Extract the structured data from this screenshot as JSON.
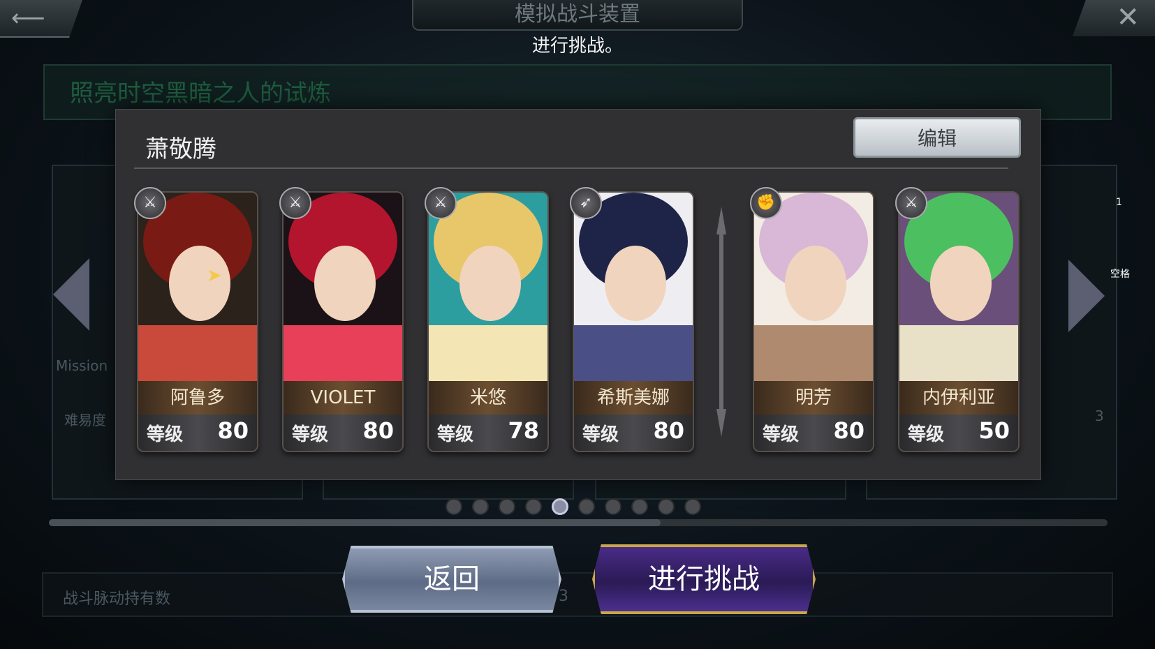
{
  "header": {
    "title": "模拟战斗装置",
    "banner": "进行挑战。"
  },
  "background": {
    "trial_title": "照亮时空黑暗之人的试炼",
    "mission_label": "Mission",
    "difficulty_label": "难易度",
    "difficulty_value": "3",
    "pulse_label": "战斗脉动持有数",
    "pulse_value": "3"
  },
  "hints": {
    "one": "1",
    "space": "空格"
  },
  "dialog": {
    "team_name": "萧敬腾",
    "edit_label": "编辑",
    "level_label": "等级",
    "characters": [
      {
        "name": "阿鲁多",
        "level": "80",
        "weapon_icon": "sword-icon",
        "palette": [
          "#7a1a14",
          "#2c221c",
          "#c94a3a"
        ]
      },
      {
        "name": "VIOLET",
        "level": "80",
        "weapon_icon": "sword-icon",
        "palette": [
          "#b3142e",
          "#1a1216",
          "#e84058"
        ]
      },
      {
        "name": "米悠",
        "level": "78",
        "weapon_icon": "sword-icon",
        "palette": [
          "#e8c66a",
          "#2c9ea0",
          "#f3e6b4"
        ]
      },
      {
        "name": "希斯美娜",
        "level": "80",
        "weapon_icon": "spear-icon",
        "palette": [
          "#1e2348",
          "#eeeef2",
          "#4a4f86"
        ]
      },
      {
        "name": "明芳",
        "level": "80",
        "weapon_icon": "fist-icon",
        "palette": [
          "#d9b7d6",
          "#f2ece4",
          "#b08a6e"
        ]
      },
      {
        "name": "内伊利亚",
        "level": "50",
        "weapon_icon": "sword-icon",
        "palette": [
          "#4cc060",
          "#6a4f7a",
          "#e9e0c8"
        ]
      }
    ]
  },
  "pager": {
    "count": 10,
    "active_index": 4
  },
  "footer": {
    "back_label": "返回",
    "challenge_label": "进行挑战"
  },
  "colors": {
    "accent_gold": "#c8a64a",
    "challenge_purple": "#2a1a55",
    "back_silver": "#8e9bb2"
  }
}
